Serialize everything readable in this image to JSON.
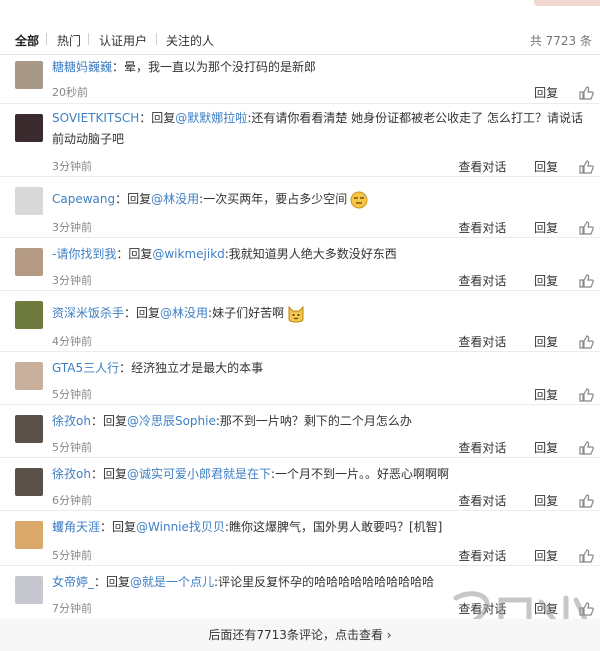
{
  "filters": {
    "items": [
      {
        "label": "全部",
        "active": true
      },
      {
        "label": "热门",
        "active": false
      },
      {
        "label": "认证用户",
        "active": false
      },
      {
        "label": "关注的人",
        "active": false
      }
    ],
    "total": "共 7723 条"
  },
  "comments": [
    {
      "user": "糖糖妈巍巍",
      "reply_prefix": "",
      "reply_to": "",
      "text": "：晕，我一直以为那个没打码的是新郎",
      "time": "20秒前",
      "view_convo": "",
      "reply": "回复",
      "emoji": ""
    },
    {
      "user": "SOVIETKITSCH",
      "reply_prefix": "：回复",
      "reply_to": "@默默娜拉啦",
      "text": ":还有请你看看清楚 她身份证都被老公收走了 怎么打工？请说话前动动脑子吧",
      "time": "3分钟前",
      "view_convo": "查看对话",
      "reply": "回复",
      "emoji": ""
    },
    {
      "user": "Capewang",
      "reply_prefix": "：回复",
      "reply_to": "@林没用",
      "text": ":一次买两年，要占多少空间",
      "time": "3分钟前",
      "view_convo": "查看对话",
      "reply": "回复",
      "emoji": "sweat-emoji"
    },
    {
      "user": "-请你找到我",
      "reply_prefix": "：回复",
      "reply_to": "@wikmejikd",
      "text": ":我就知道男人绝大多数没好东西",
      "time": "3分钟前",
      "view_convo": "查看对话",
      "reply": "回复",
      "emoji": ""
    },
    {
      "user": "资深米饭杀手",
      "reply_prefix": "：回复",
      "reply_to": "@林没用",
      "text": ":妹子们好苦啊",
      "time": "4分钟前",
      "view_convo": "查看对话",
      "reply": "回复",
      "emoji": "cat-emoji"
    },
    {
      "user": "GTA5三人行",
      "reply_prefix": "",
      "reply_to": "",
      "text": "：经济独立才是最大的本事",
      "time": "5分钟前",
      "view_convo": "",
      "reply": "回复",
      "emoji": ""
    },
    {
      "user": "徐孜oh",
      "reply_prefix": "：回复",
      "reply_to": "@冷思辰Sophie",
      "text": ":那不到一片呐？剩下的二个月怎么办",
      "time": "5分钟前",
      "view_convo": "查看对话",
      "reply": "回复",
      "emoji": ""
    },
    {
      "user": "徐孜oh",
      "reply_prefix": "：回复",
      "reply_to": "@诚实可爱小郎君就是在下",
      "text": ":一个月不到一片。。好恶心啊啊啊",
      "time": "6分钟前",
      "view_convo": "查看对话",
      "reply": "回复",
      "emoji": ""
    },
    {
      "user": "蠼角天涯",
      "reply_prefix": "：回复",
      "reply_to": "@Winnie找贝贝",
      "text": ":瞧你这爆脾气，国外男人敢要吗？[机智]",
      "time": "5分钟前",
      "view_convo": "查看对话",
      "reply": "回复",
      "emoji": ""
    },
    {
      "user": "女帝婷_",
      "reply_prefix": "：回复",
      "reply_to": "@就是一个点儿",
      "text": ":评论里反复怀孕的哈哈哈哈哈哈哈哈哈哈",
      "time": "7分钟前",
      "view_convo": "查看对话",
      "reply": "回复",
      "emoji": ""
    }
  ],
  "more_link": "后面还有7713条评论，点击查看",
  "colors": {
    "link": "#3f7fc4",
    "time": "#888888",
    "more_bg": "#f7f7f7"
  }
}
